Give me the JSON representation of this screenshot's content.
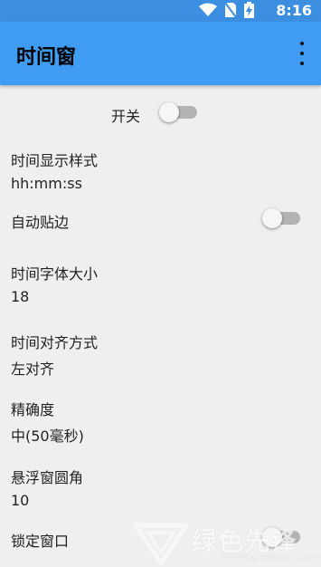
{
  "status_bar": {
    "time": "8:16",
    "icons": [
      "wifi-icon",
      "no-sim-icon",
      "battery-charging-icon"
    ]
  },
  "app_bar": {
    "title": "时间窗",
    "menu_icon": "more-vert-icon"
  },
  "master_switch": {
    "label": "开关",
    "on": false
  },
  "settings": {
    "time_format": {
      "label": "时间显示样式",
      "value": "hh:mm:ss"
    },
    "auto_snap": {
      "label": "自动贴边",
      "on": false
    },
    "font_size": {
      "label": "时间字体大小",
      "value": "18"
    },
    "alignment": {
      "label": "时间对齐方式",
      "value": "左对齐"
    },
    "precision": {
      "label": "精确度",
      "value": "中(50毫秒)"
    },
    "corner_radius": {
      "label": "悬浮窗圆角",
      "value": "10"
    },
    "lock_window": {
      "label": "锁定窗口",
      "on": false
    }
  },
  "watermark": {
    "text": "绿色先锋",
    "url": "www.greenxf.com"
  },
  "colors": {
    "app_bar": "#3f9cf2",
    "status_bar": "#3c8fe0",
    "background": "#efefef",
    "switch_track_off": "#b3b3b3"
  }
}
